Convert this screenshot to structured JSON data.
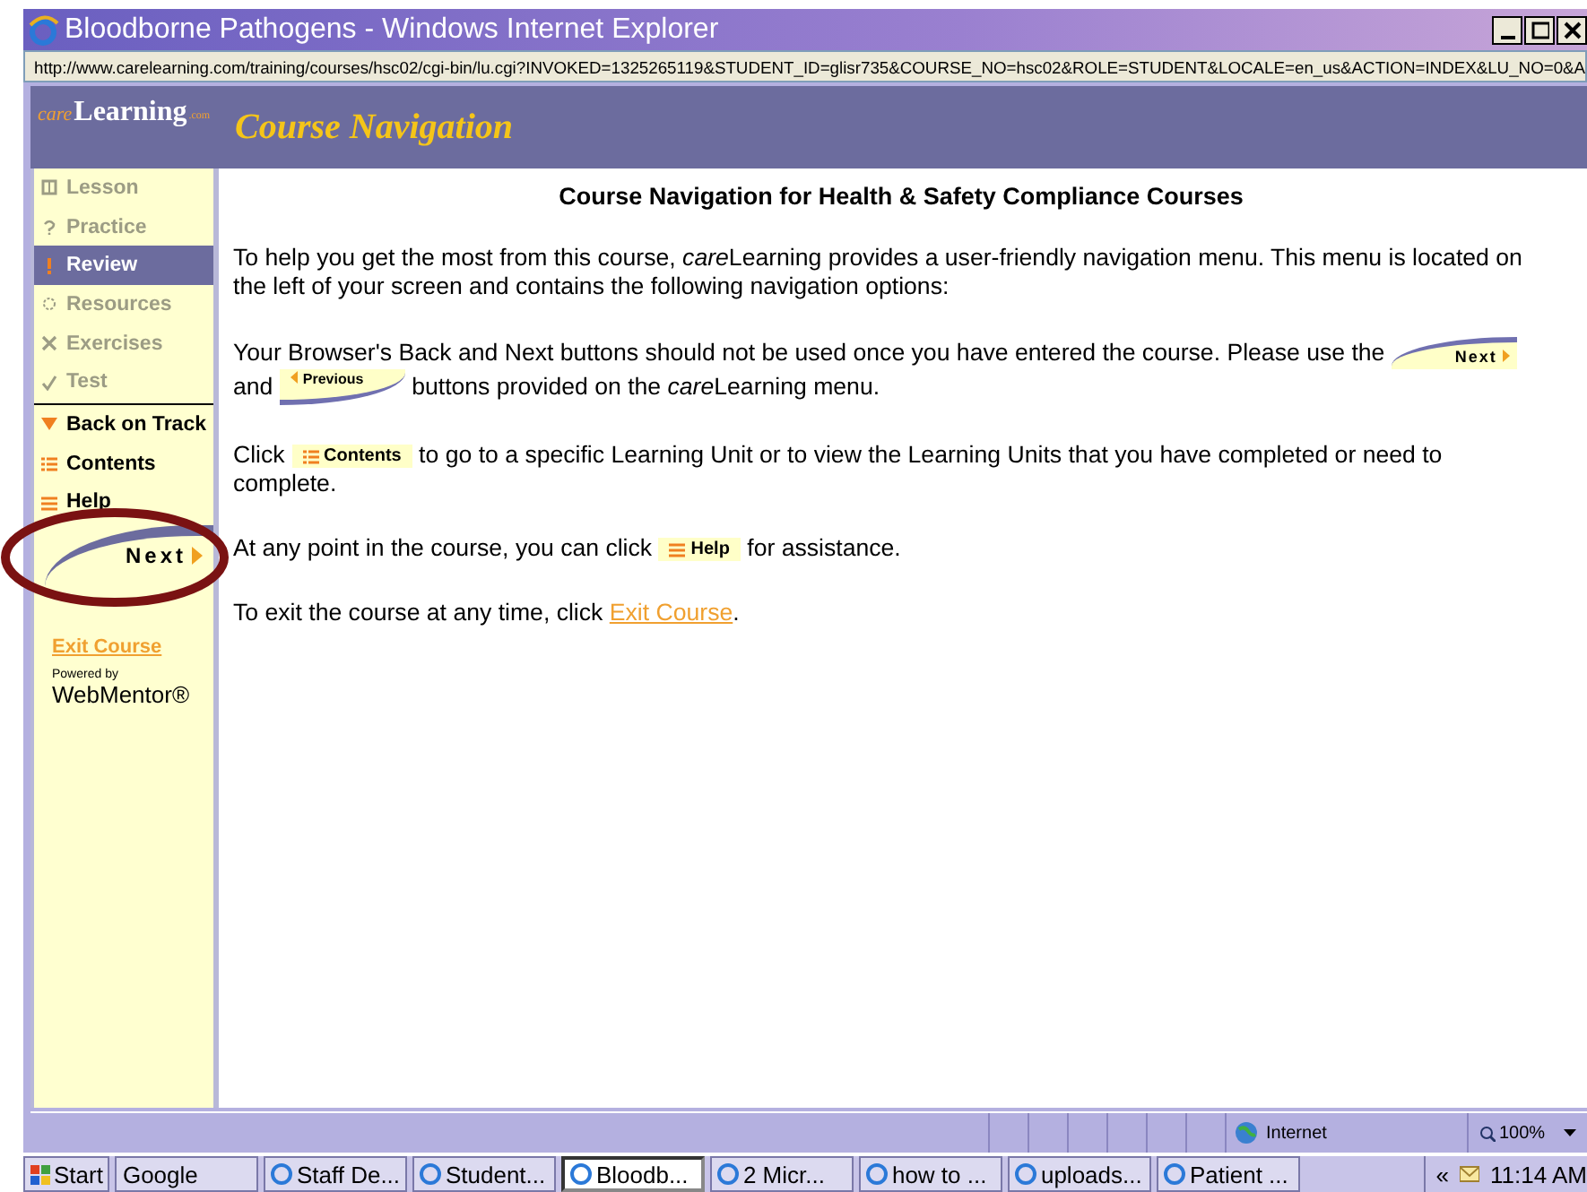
{
  "window": {
    "title": "Bloodborne Pathogens - Windows Internet Explorer"
  },
  "address_bar": {
    "url": "http://www.carelearning.com/training/courses/hsc02/cgi-bin/lu.cgi?INVOKED=1325265119&STUDENT_ID=glisr735&COURSE_NO=hsc02&ROLE=STUDENT&LOCALE=en_us&ACTION=INDEX&LU_NO=0&A"
  },
  "header": {
    "logo_prefix": "care",
    "logo_main": "Learning",
    "logo_suffix": ".com",
    "title": "Course Navigation"
  },
  "sidebar": {
    "steps": [
      {
        "label": "Lesson",
        "selected": false,
        "disabled": true
      },
      {
        "label": "Practice",
        "selected": false,
        "disabled": true
      },
      {
        "label": "Review",
        "selected": true,
        "disabled": false
      },
      {
        "label": "Resources",
        "selected": false,
        "disabled": true
      },
      {
        "label": "Exercises",
        "selected": false,
        "disabled": true
      },
      {
        "label": "Test",
        "selected": false,
        "disabled": true
      }
    ],
    "tools": [
      {
        "label": "Back on Track"
      },
      {
        "label": "Contents"
      },
      {
        "label": "Help"
      }
    ],
    "next_button": "Next",
    "exit_link": "Exit Course",
    "powered_by": "Powered by",
    "brand": "WebMentor®"
  },
  "content": {
    "heading": "Course Navigation for Health & Safety Compliance Courses",
    "paragraphs": [
      [
        [
          {
            "kind": "text",
            "text": "To help you get the most from this course, "
          },
          {
            "kind": "italic",
            "text": "care"
          },
          {
            "kind": "text",
            "text": "Learning provides a user-friendly navigation menu. This menu is located on"
          }
        ],
        [
          {
            "kind": "text",
            "text": "the left of your screen and contains the following navigation options:"
          }
        ]
      ],
      [
        [
          {
            "kind": "text",
            "text": "Your Browser's Back and Next buttons should not be used once you have entered the course. Please use the "
          },
          {
            "kind": "next",
            "label": "Next"
          }
        ],
        [
          {
            "kind": "text",
            "text": "and "
          },
          {
            "kind": "previous",
            "label": "Previous"
          },
          {
            "kind": "text",
            "text": " buttons provided on the "
          },
          {
            "kind": "italic",
            "text": "care"
          },
          {
            "kind": "text",
            "text": "Learning menu."
          }
        ]
      ],
      [
        [
          {
            "kind": "text",
            "text": "Click "
          },
          {
            "kind": "menu",
            "label": "Contents"
          },
          {
            "kind": "text",
            "text": " to go to a specific Learning Unit or to view the Learning Units that you have completed or need to"
          }
        ],
        [
          {
            "kind": "text",
            "text": "complete."
          }
        ]
      ],
      [
        [
          {
            "kind": "text",
            "text": "At any point in the course, you can click "
          },
          {
            "kind": "menu",
            "label": "Help"
          },
          {
            "kind": "text",
            "text": " for assistance."
          }
        ]
      ],
      [
        [
          {
            "kind": "text",
            "text": "To exit the course at any time, click "
          },
          {
            "kind": "link",
            "label": "Exit Course"
          },
          {
            "kind": "text",
            "text": "."
          }
        ]
      ]
    ]
  },
  "status_bar": {
    "zone": "Internet",
    "zoom": "100%"
  },
  "taskbar": {
    "start": "Start",
    "items": [
      {
        "label": "Google",
        "selected": false
      },
      {
        "label": "Staff De...",
        "selected": false
      },
      {
        "label": "Student...",
        "selected": false
      },
      {
        "label": "Bloodb...",
        "selected": true
      },
      {
        "label": "2 Micr...",
        "selected": false
      },
      {
        "label": "how to ...",
        "selected": false
      },
      {
        "label": "uploads...",
        "selected": false
      },
      {
        "label": "Patient ...",
        "selected": false
      }
    ],
    "tray_toggle": "«",
    "time": "11:14 AM"
  }
}
